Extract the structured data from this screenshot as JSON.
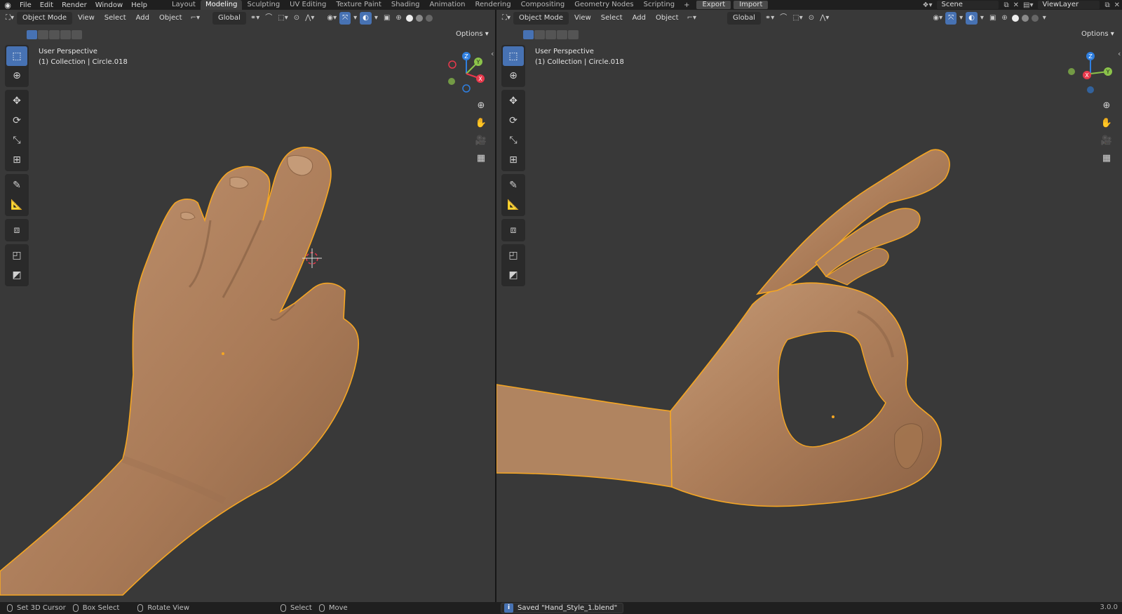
{
  "topbar": {
    "menus": [
      "File",
      "Edit",
      "Render",
      "Window",
      "Help"
    ],
    "workspaces": [
      "Layout",
      "Modeling",
      "Sculpting",
      "UV Editing",
      "Texture Paint",
      "Shading",
      "Animation",
      "Rendering",
      "Compositing",
      "Geometry Nodes",
      "Scripting"
    ],
    "active_workspace": "Modeling",
    "export_label": "Export",
    "import_label": "Import",
    "scene_name": "Scene",
    "view_layer": "ViewLayer"
  },
  "viewport_header": {
    "mode": "Object Mode",
    "menus": [
      "View",
      "Select",
      "Add",
      "Object"
    ],
    "orientation": "Global",
    "options_label": "Options"
  },
  "left_view": {
    "title": "User Perspective",
    "collection": "(1) Collection | Circle.018"
  },
  "right_view": {
    "title": "User Perspective",
    "collection": "(1) Collection | Circle.018"
  },
  "gizmo_axes": {
    "x": "X",
    "y": "Y",
    "z": "Z"
  },
  "statusbar": {
    "items": [
      "Set 3D Cursor",
      "Box Select",
      "Rotate View",
      "Select",
      "Move"
    ],
    "message": "Saved \"Hand_Style_1.blend\"",
    "version": "3.0.0"
  },
  "colors": {
    "viewport_bg": "#393939",
    "selection_outline": "#f5a623",
    "skin": "#b88a64",
    "accent_blue": "#4772b3",
    "axis_x": "#e8394c",
    "axis_y": "#8bc34a",
    "axis_z": "#2f7fe0"
  },
  "icons": [
    "blender-logo",
    "cursor-icon",
    "move-icon",
    "rotate-icon",
    "scale-icon",
    "transform-icon",
    "annotate-icon",
    "measure-icon",
    "add-cube-icon",
    "zoom-icon",
    "hand-pan-icon",
    "camera-icon",
    "grid-icon",
    "info-icon"
  ]
}
